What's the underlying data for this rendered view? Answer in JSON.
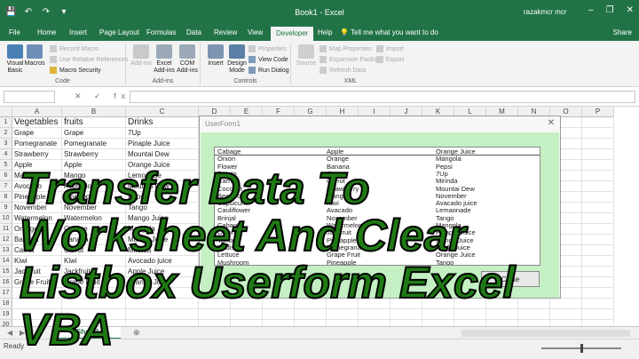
{
  "titlebar": {
    "title": "Book1 - Excel",
    "user": "razakmcr mcr",
    "minimize": "–",
    "restore": "❐",
    "close": "✕",
    "qat": [
      "💾",
      "↶",
      "↷",
      "▾"
    ]
  },
  "tabs": [
    "File",
    "Home",
    "Insert",
    "Page Layout",
    "Formulas",
    "Data",
    "Review",
    "View",
    "Developer",
    "Help"
  ],
  "active_tab": "Developer",
  "tell_me": "Tell me what you want to do",
  "share": "Share",
  "ribbon": {
    "code": {
      "name": "Code",
      "visual_basic": "Visual Basic",
      "macros": "Macros",
      "record_macro": "Record Macro",
      "use_relative": "Use Relative References",
      "macro_security": "Macro Security"
    },
    "addins": {
      "name": "Add-ins",
      "addins": "Add-ins",
      "excel_addins": "Excel Add-ins",
      "com_addins": "COM Add-ins"
    },
    "controls": {
      "name": "Controls",
      "insert": "Insert",
      "design_mode": "Design Mode",
      "properties": "Properties",
      "view_code": "View Code",
      "run_dialog": "Run Dialog"
    },
    "xml": {
      "name": "XML",
      "source": "Source",
      "map_properties": "Map Properties",
      "expansion_packs": "Expansion Packs",
      "refresh_data": "Refresh Data",
      "import": "Import",
      "export": "Export"
    }
  },
  "formula_bar": {
    "name_box": "",
    "fx": "✕ ✓ fx",
    "value": ""
  },
  "columns": [
    "A",
    "B",
    "C",
    "D",
    "E",
    "F",
    "G",
    "H",
    "I",
    "J",
    "K",
    "L",
    "M",
    "N",
    "O",
    "P"
  ],
  "rows": [
    "1",
    "2",
    "3",
    "4",
    "5",
    "6",
    "7",
    "8",
    "9",
    "10",
    "11",
    "12",
    "13",
    "14",
    "15",
    "16",
    "17",
    "18",
    "19",
    "20"
  ],
  "sheet": {
    "headers": [
      "Vegetables",
      "fruits",
      "Drinks"
    ],
    "data": [
      [
        "Grape",
        "Grape",
        "7Up"
      ],
      [
        "Pomegranate",
        "Pomegranate",
        "Pinaple Juice"
      ],
      [
        "Strawberry",
        "Strawberry",
        "Mountai Dew"
      ],
      [
        "Apple",
        "Apple",
        "Orange Juice"
      ],
      [
        "Mango",
        "Mango",
        "Lemonade"
      ],
      [
        "Avocado",
        "Avocado",
        "Mountai Dew"
      ],
      [
        "Pineapple",
        "Pineapple",
        "Pepsi"
      ],
      [
        "November",
        "November",
        "Tango"
      ],
      [
        "Watermelon",
        "Watermelon",
        "Mango Juice"
      ],
      [
        "Orange",
        "Orange",
        "Mangola"
      ],
      [
        "Banana",
        "Banana",
        "Mango Juice"
      ],
      [
        "Carrot",
        "Carrot",
        "Mirinda"
      ],
      [
        "Kiwi",
        "Kiwi",
        "Avocado juice"
      ],
      [
        "Jackfruit",
        "Jackfruit",
        "Apple Juice"
      ],
      [
        "Grape Fruit",
        "Grape Fruit",
        "Orange Juice"
      ]
    ]
  },
  "userform": {
    "title": "UserForm1",
    "close": "✕",
    "listbox": [
      [
        "Cabage",
        "Apple",
        "Orange Juice"
      ],
      [
        "Onion",
        "Orange",
        "Mangola"
      ],
      [
        "Flower",
        "Banana",
        "Pepsi"
      ],
      [
        "Potato",
        "Grape",
        "7Up"
      ],
      [
        "Carrot",
        "Carrot",
        "Mirinda"
      ],
      [
        "Coconut",
        "Strawberry",
        "Mountai Dew"
      ],
      [
        "Beetroot",
        "Mango",
        "November"
      ],
      [
        "Capsicum",
        "Kiwi",
        "Avacado juice"
      ],
      [
        "Cauliflower",
        "Avacado",
        "Lemaonade"
      ],
      [
        "Brinjal",
        "November",
        "Tango"
      ],
      [
        "Cabage",
        "Watermelon",
        "Mangola"
      ],
      [
        "Onion",
        "Jackfruit",
        "Pinaple Juice"
      ],
      [
        "Tomato",
        "Pineapple",
        "Mango Juice"
      ],
      [
        "Radish",
        "Pomegranate",
        "Apple Juice"
      ],
      [
        "Lettuce",
        "Grape Fruit",
        "Orange Juice"
      ],
      [
        "Mushroom",
        "Pineapple",
        "Tango"
      ]
    ],
    "button": "Close"
  },
  "sheet_tabs": {
    "active": "Sheet1",
    "add": "⊕",
    "nav_prev": "◀",
    "nav_next": "▶"
  },
  "status": {
    "ready": "Ready"
  },
  "overlay": [
    "Transfer Data To",
    "Worksheet And Clear",
    "Listbox Userform Excel",
    "VBA"
  ]
}
